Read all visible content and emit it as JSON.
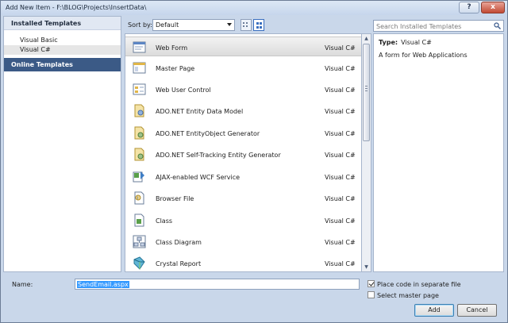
{
  "window": {
    "title": "Add New Item - F:\\BLOG\\Projects\\InsertData\\",
    "help_glyph": "?",
    "close_glyph": "x"
  },
  "left_panel": {
    "header": "Installed Templates",
    "items": [
      {
        "label": "Visual Basic"
      },
      {
        "label": "Visual C#"
      }
    ],
    "online": "Online Templates"
  },
  "toolbar": {
    "sort_label": "Sort by:",
    "sort_value": "Default"
  },
  "list": {
    "items": [
      {
        "name": "Web Form",
        "lang": "Visual C#",
        "icon": "web-form-icon"
      },
      {
        "name": "Master Page",
        "lang": "Visual C#",
        "icon": "master-page-icon"
      },
      {
        "name": "Web User Control",
        "lang": "Visual C#",
        "icon": "user-control-icon"
      },
      {
        "name": "ADO.NET Entity Data Model",
        "lang": "Visual C#",
        "icon": "entity-model-icon"
      },
      {
        "name": "ADO.NET EntityObject Generator",
        "lang": "Visual C#",
        "icon": "entity-generator-icon"
      },
      {
        "name": "ADO.NET Self-Tracking Entity Generator",
        "lang": "Visual C#",
        "icon": "self-tracking-generator-icon"
      },
      {
        "name": "AJAX-enabled WCF Service",
        "lang": "Visual C#",
        "icon": "wcf-service-icon"
      },
      {
        "name": "Browser File",
        "lang": "Visual C#",
        "icon": "browser-file-icon"
      },
      {
        "name": "Class",
        "lang": "Visual C#",
        "icon": "class-icon"
      },
      {
        "name": "Class Diagram",
        "lang": "Visual C#",
        "icon": "class-diagram-icon"
      },
      {
        "name": "Crystal Report",
        "lang": "Visual C#",
        "icon": "crystal-report-icon"
      }
    ]
  },
  "search": {
    "placeholder": "Search Installed Templates"
  },
  "details": {
    "type_label": "Type:",
    "type_value": "Visual C#",
    "description": "A form for Web Applications"
  },
  "bottom": {
    "name_label": "Name:",
    "name_value": "SendEmail.aspx",
    "place_code_label": "Place code in separate file",
    "place_code_checked": true,
    "master_page_label": "Select master page",
    "master_page_checked": false,
    "add_label": "Add",
    "cancel_label": "Cancel"
  },
  "colors": {
    "online_bg": "#3b5a86",
    "frame": "#c9d7ea",
    "selection": "#3399ff"
  }
}
